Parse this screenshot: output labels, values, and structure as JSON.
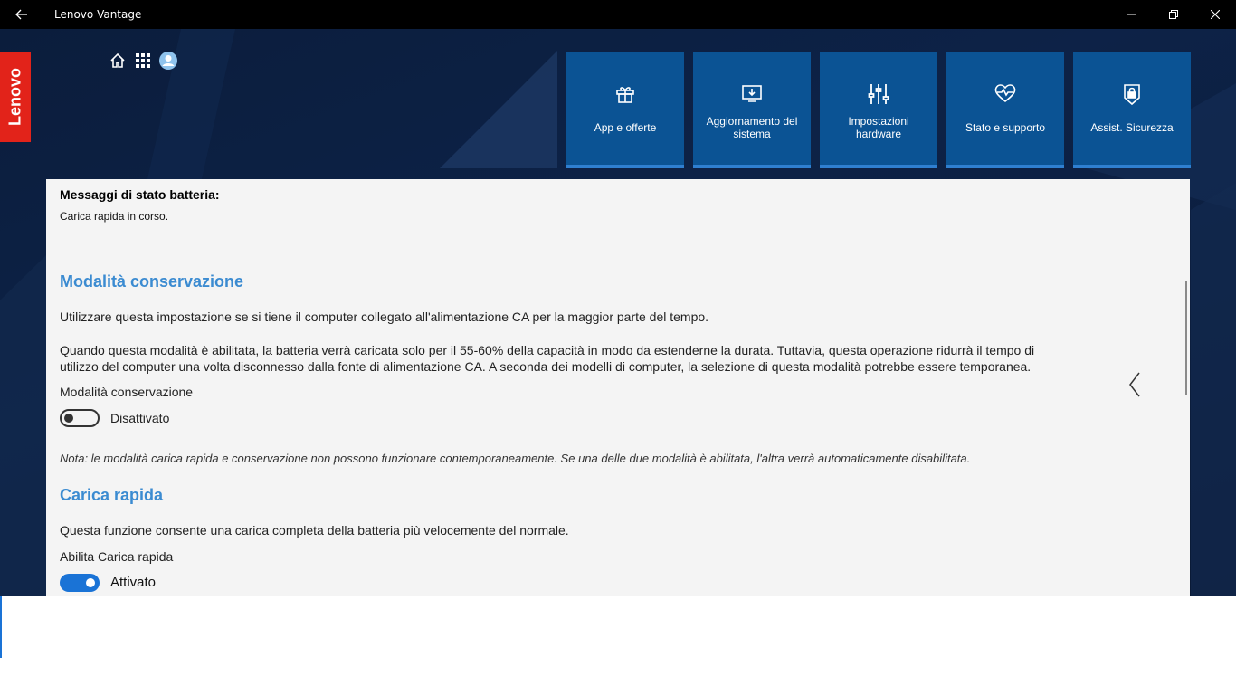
{
  "window": {
    "title": "Lenovo Vantage"
  },
  "brand": {
    "logo_text": "Lenovo",
    "logo_color": "#e2231a",
    "tile_color": "#0b5394",
    "accent": "#3b8bd1"
  },
  "top_icons": [
    "home-icon",
    "apps-grid-icon",
    "user-avatar-icon"
  ],
  "tiles": [
    {
      "label": "App e offerte",
      "icon": "gift-icon"
    },
    {
      "label": "Aggiornamento del sistema",
      "icon": "system-update-icon"
    },
    {
      "label": "Impostazioni hardware",
      "icon": "sliders-icon"
    },
    {
      "label": "Stato e supporto",
      "icon": "heart-pulse-icon"
    },
    {
      "label": "Assist. Sicurezza",
      "icon": "lock-shield-icon"
    }
  ],
  "content": {
    "status_heading": "Messaggi di stato batteria:",
    "status_text": "Carica rapida in corso.",
    "conservation": {
      "title": "Modalità conservazione",
      "desc1": "Utilizzare questa impostazione se si tiene il computer collegato all'alimentazione CA per la maggior parte del tempo.",
      "desc2": "Quando questa modalità è abilitata, la batteria verrà caricata solo per il 55-60% della capacità in modo da estenderne la durata. Tuttavia, questa operazione ridurrà il tempo di utilizzo del computer una volta disconnesso dalla fonte di alimentazione CA. A seconda dei modelli di computer, la selezione di questa modalità potrebbe essere temporanea.",
      "toggle_label": "Modalità conservazione",
      "toggle_state": "Disattivato"
    },
    "note": "Nota: le modalità carica rapida e conservazione non possono funzionare contemporaneamente. Se una delle due modalità è abilitata, l'altra verrà automaticamente disabilitata.",
    "rapid_charge": {
      "title": "Carica rapida",
      "desc": "Questa funzione consente una carica completa della batteria più velocemente del normale.",
      "toggle_label": "Abilita Carica rapida",
      "toggle_state": "Attivato"
    }
  }
}
